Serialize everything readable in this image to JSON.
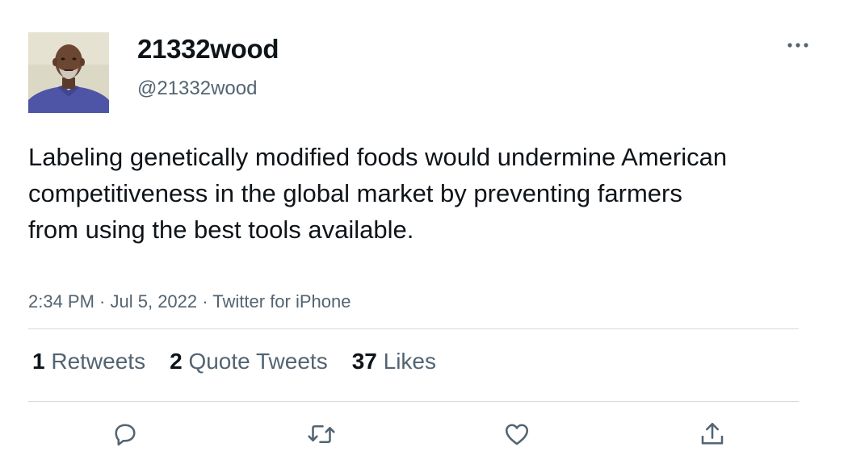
{
  "tweet": {
    "display_name": "21332wood",
    "handle": "@21332wood",
    "text": "Labeling genetically modified foods would undermine American competitiveness in the global market by preventing farmers from using the best tools available.",
    "time": "2:34 PM",
    "separator": " · ",
    "date": "Jul 5, 2022",
    "source": "Twitter for iPhone"
  },
  "stats": {
    "retweets_count": "1",
    "retweets_label": "Retweets",
    "quotes_count": "2",
    "quotes_label": "Quote Tweets",
    "likes_count": "37",
    "likes_label": "Likes"
  },
  "icons": {
    "more": "more-horizontal-icon",
    "reply": "reply-icon",
    "retweet": "retweet-icon",
    "like": "heart-icon",
    "share": "share-icon"
  },
  "colors": {
    "text_primary": "#0f1419",
    "text_secondary": "#536471",
    "divider": "#d9d9d9"
  }
}
